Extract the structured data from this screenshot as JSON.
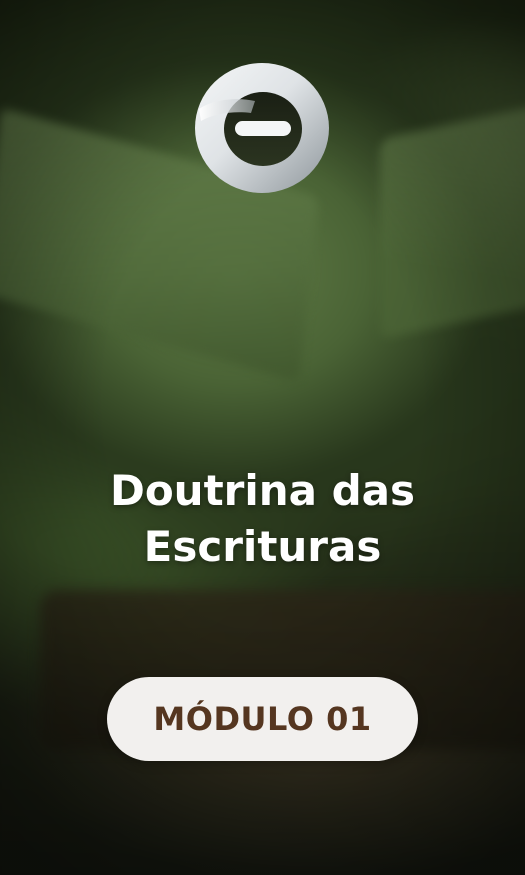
{
  "card": {
    "logo_icon": "ring-minus-logo-icon",
    "title_line1": "Doutrina das",
    "title_line2": "Escrituras",
    "module_label": "MÓDULO 01"
  },
  "colors": {
    "title_text": "#ffffff",
    "pill_background": "#f2f0ee",
    "pill_text": "#553620",
    "background_tint": "#2a3a1c"
  }
}
